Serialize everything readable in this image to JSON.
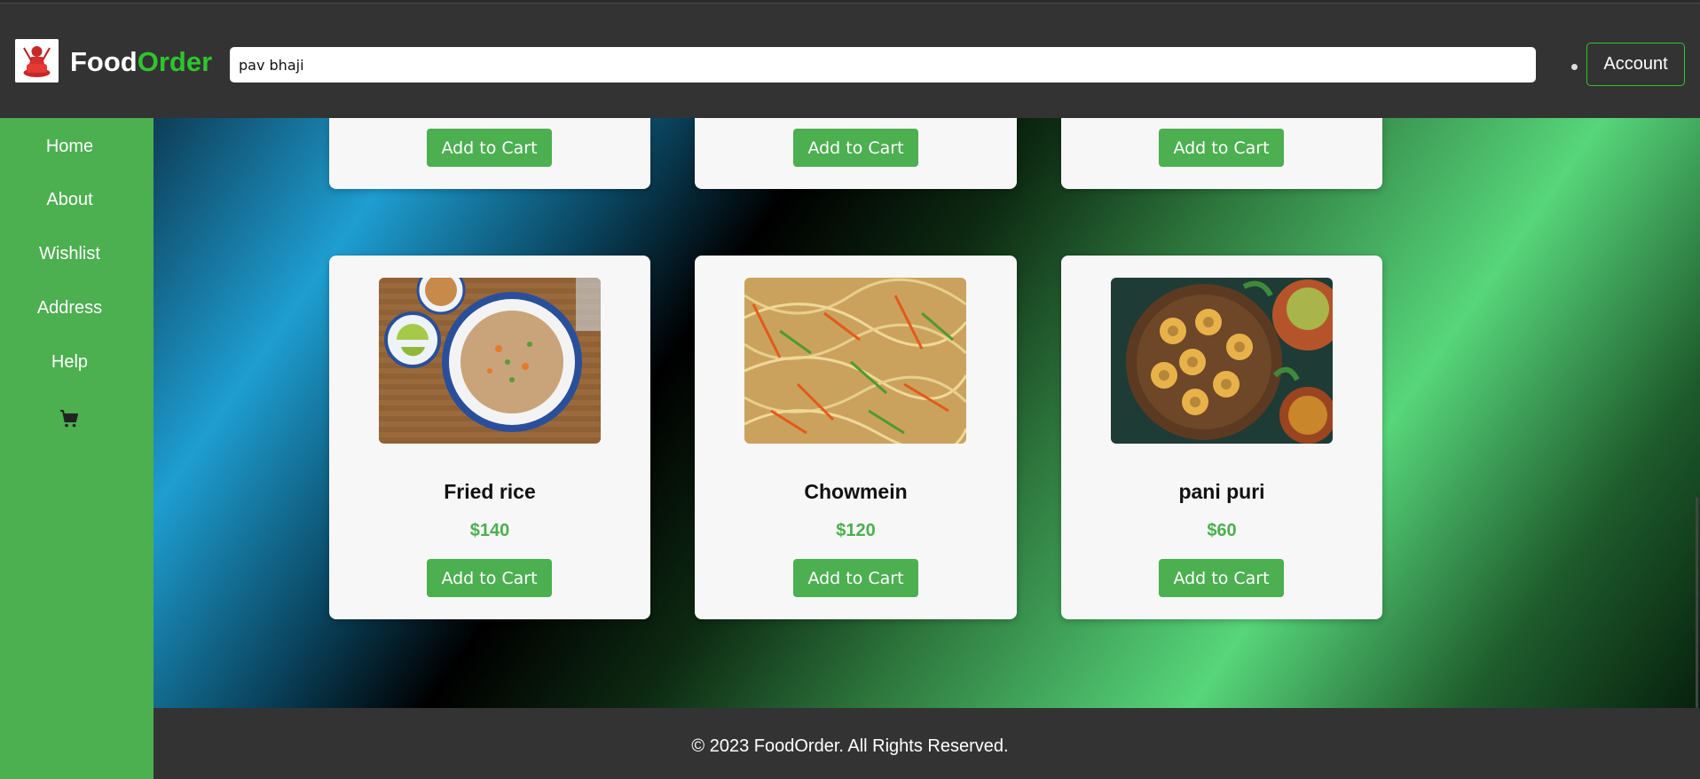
{
  "brand": {
    "part1": "Food",
    "part2": "Order"
  },
  "search": {
    "value": "pav bhaji"
  },
  "header": {
    "account_label": "Account"
  },
  "sidebar": {
    "items": [
      {
        "label": "Home"
      },
      {
        "label": "About"
      },
      {
        "label": "Wishlist"
      },
      {
        "label": "Address"
      },
      {
        "label": "Help"
      }
    ],
    "cart_icon": "cart-icon"
  },
  "top_row": [
    {
      "button_label": "Add to Cart"
    },
    {
      "button_label": "Add to Cart"
    },
    {
      "button_label": "Add to Cart"
    }
  ],
  "products": [
    {
      "name": "Fried rice",
      "price": "$140",
      "button_label": "Add to Cart",
      "image": "fried-rice-photo"
    },
    {
      "name": "Chowmein",
      "price": "$120",
      "button_label": "Add to Cart",
      "image": "chowmein-photo"
    },
    {
      "name": "pani puri",
      "price": "$60",
      "button_label": "Add to Cart",
      "image": "pani-puri-photo"
    }
  ],
  "footer": {
    "text": "© 2023 FoodOrder. All Rights Reserved."
  },
  "colors": {
    "accent": "#4caf50",
    "brand_green": "#2ec52e",
    "header_bg": "#333333"
  }
}
